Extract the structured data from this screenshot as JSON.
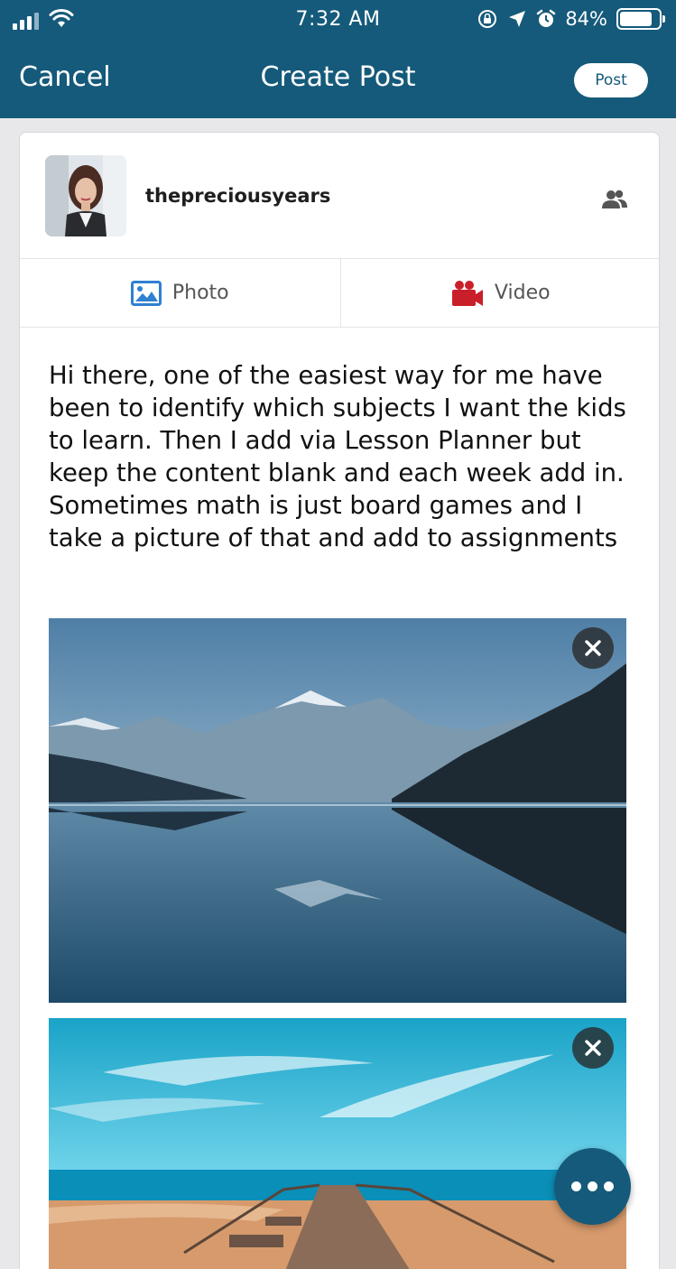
{
  "status_bar": {
    "time": "7:32 AM",
    "battery_percent": "84%",
    "battery_level": 0.84
  },
  "header": {
    "cancel_label": "Cancel",
    "title": "Create Post",
    "post_label": "Post",
    "background_color": "#155a7a"
  },
  "composer": {
    "username": "thepreciousyears",
    "audience_icon": "people-icon",
    "media_tabs": [
      {
        "label": "Photo",
        "icon": "photo-icon",
        "color": "#2f80d1"
      },
      {
        "label": "Video",
        "icon": "video-camera-icon",
        "color": "#c91f2b"
      }
    ],
    "text": "Hi there, one of the easiest way for me have been to identify which subjects I want the kids to learn. Then I add via Lesson Planner but keep the content blank and each week add in.  Sometimes math is just board games and I take a picture of that and add to assignments",
    "attachments": [
      {
        "kind": "photo",
        "remove_icon": "close-icon"
      },
      {
        "kind": "photo",
        "remove_icon": "close-icon"
      }
    ]
  },
  "fab": {
    "icon": "more-dots-icon"
  }
}
